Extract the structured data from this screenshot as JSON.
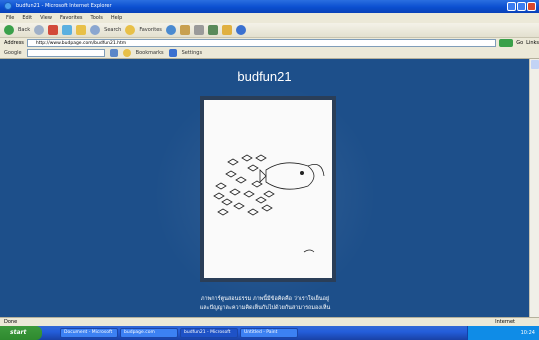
{
  "window": {
    "title": "budfun21 - Microsoft Internet Explorer"
  },
  "menu": [
    "File",
    "Edit",
    "View",
    "Favorites",
    "Tools",
    "Help"
  ],
  "toolbar": {
    "back_label": "Back",
    "search_label": "Search",
    "favorites_label": "Favorites"
  },
  "address": {
    "label": "Address",
    "url": "http://www.budpage.com/budfun21.htm",
    "go_label": "Go",
    "links_label": "Links"
  },
  "googlebar": {
    "label": "Google",
    "bookmarks_label": "Bookmarks",
    "settings_label": "Settings"
  },
  "page": {
    "title": "budfun21",
    "caption_line1": "ภาพการ์ตูนสอนธรรม ภาพนี้มีข้อคิดคือ ว่าเราใจเย็นอยู่",
    "caption_line2": "และปัญญาละความคิดเห็นกับไปด้วยกันสามารถมองเห็น"
  },
  "status": {
    "left": "Done",
    "zone": "Internet"
  },
  "taskbar": {
    "start_label": "start",
    "tasks": [
      "Document - Microsoft",
      "budpage.com",
      "budfun21 - Microsoft",
      "Untitled - Paint"
    ],
    "clock": "10:24"
  },
  "colors": {
    "page_background": "#1d4f8a",
    "title_text": "#ffffff"
  }
}
